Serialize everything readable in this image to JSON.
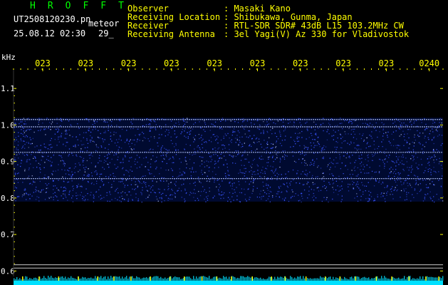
{
  "header": {
    "logo": "HROFFT",
    "file_name": "UT2508120230.pn",
    "mode": "meteor",
    "datetime": "25.08.12 02:30",
    "frame": "29_",
    "observer_label": "Observer",
    "observer_value": ": Masaki Kano",
    "location_label": "Receiving Location",
    "location_value": ": Shibukawa, Gunma, Japan",
    "receiver_label": "Receiver",
    "receiver_value": ": RTL-SDR SDR# 43dB L15 103.2MHz CW",
    "antenna_label": "Receiving Antenna",
    "antenna_value": ": 3el Yagi(V) Az 330 for Vladivostok"
  },
  "chart_data": {
    "type": "heatmap",
    "ylabel": "kHz",
    "x_tick_labels": [
      "023",
      "023",
      "023",
      "023",
      "023",
      "023",
      "023",
      "023",
      "023",
      "0240"
    ],
    "y_ticks": [
      1.1,
      1.0,
      0.9,
      0.8,
      0.7,
      0.6
    ],
    "y_tick_labels": [
      "1.1",
      "1.0",
      "0.9",
      "0.8",
      "0.7",
      "0.6"
    ],
    "ylim": [
      0.585,
      1.155
    ],
    "noise_band_khz": [
      0.79,
      1.02
    ],
    "carrier_lines_khz": [
      1.015,
      0.995,
      0.925,
      0.853
    ],
    "reference_lines_khz": [
      0.617,
      0.608
    ],
    "colors": {
      "background": "#000000",
      "signal": "#3a55ff",
      "signal_bright": "#b8c8ff",
      "ticks": "#ffff00",
      "axis_labels": "#ffffff",
      "reference_line": "#c8c8c8",
      "strip": "#00e0ff"
    }
  }
}
